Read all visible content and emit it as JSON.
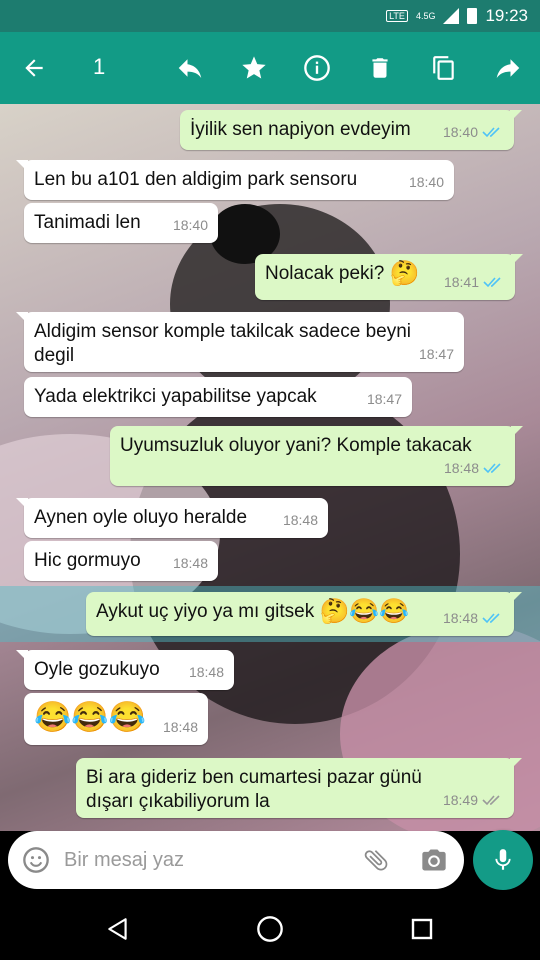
{
  "status_bar": {
    "network": "LTE",
    "network_speed": "4.5G",
    "time": "19:23"
  },
  "toolbar": {
    "selected_count": "1",
    "icons": [
      "back-arrow-icon",
      "reply-icon",
      "star-icon",
      "info-icon",
      "delete-icon",
      "copy-icon",
      "forward-icon"
    ]
  },
  "messages": [
    {
      "dir": "out",
      "text": "İyilik sen napiyon evdeyim",
      "time": "18:40",
      "ticks": "read"
    },
    {
      "dir": "in",
      "text": "Len bu a101 den aldigim park sensoru",
      "time": "18:40"
    },
    {
      "dir": "in",
      "text": "Tanimadi len",
      "time": "18:40"
    },
    {
      "dir": "out",
      "text": "Nolacak peki?",
      "emoji": "🤔",
      "time": "18:41",
      "ticks": "read"
    },
    {
      "dir": "in",
      "text": "Aldigim sensor komple takilcak sadece beyni degil",
      "time": "18:47"
    },
    {
      "dir": "in",
      "text": "Yada elektrikci yapabilitse yapcak",
      "time": "18:47"
    },
    {
      "dir": "out",
      "text": "Uyumsuzluk oluyor yani? Komple takacak",
      "time": "18:48",
      "ticks": "read"
    },
    {
      "dir": "in",
      "text": "Aynen oyle oluyo heralde",
      "time": "18:48"
    },
    {
      "dir": "in",
      "text": "Hic gormuyo",
      "time": "18:48"
    },
    {
      "dir": "out",
      "text": "Aykut uç yiyo ya mı gitsek",
      "emoji": "🤔😂😂",
      "time": "18:48",
      "ticks": "read",
      "selected": true
    },
    {
      "dir": "in",
      "text": "Oyle gozukuyo",
      "time": "18:48"
    },
    {
      "dir": "in",
      "text": "",
      "emoji": "😂😂😂",
      "time": "18:48"
    },
    {
      "dir": "out",
      "text": "Bi ara gideriz ben cumartesi pazar günü dışarı çıkabiliyorum la",
      "time": "18:49",
      "ticks": "sent"
    }
  ],
  "composer": {
    "placeholder": "Bir mesaj yaz"
  },
  "colors": {
    "status_bar": "#1d7c6f",
    "toolbar": "#129b86",
    "outgoing_bubble": "#dcf8c6",
    "incoming_bubble": "#ffffff",
    "read_ticks": "#4fc3f7",
    "selection_highlight": "#50bec8"
  }
}
